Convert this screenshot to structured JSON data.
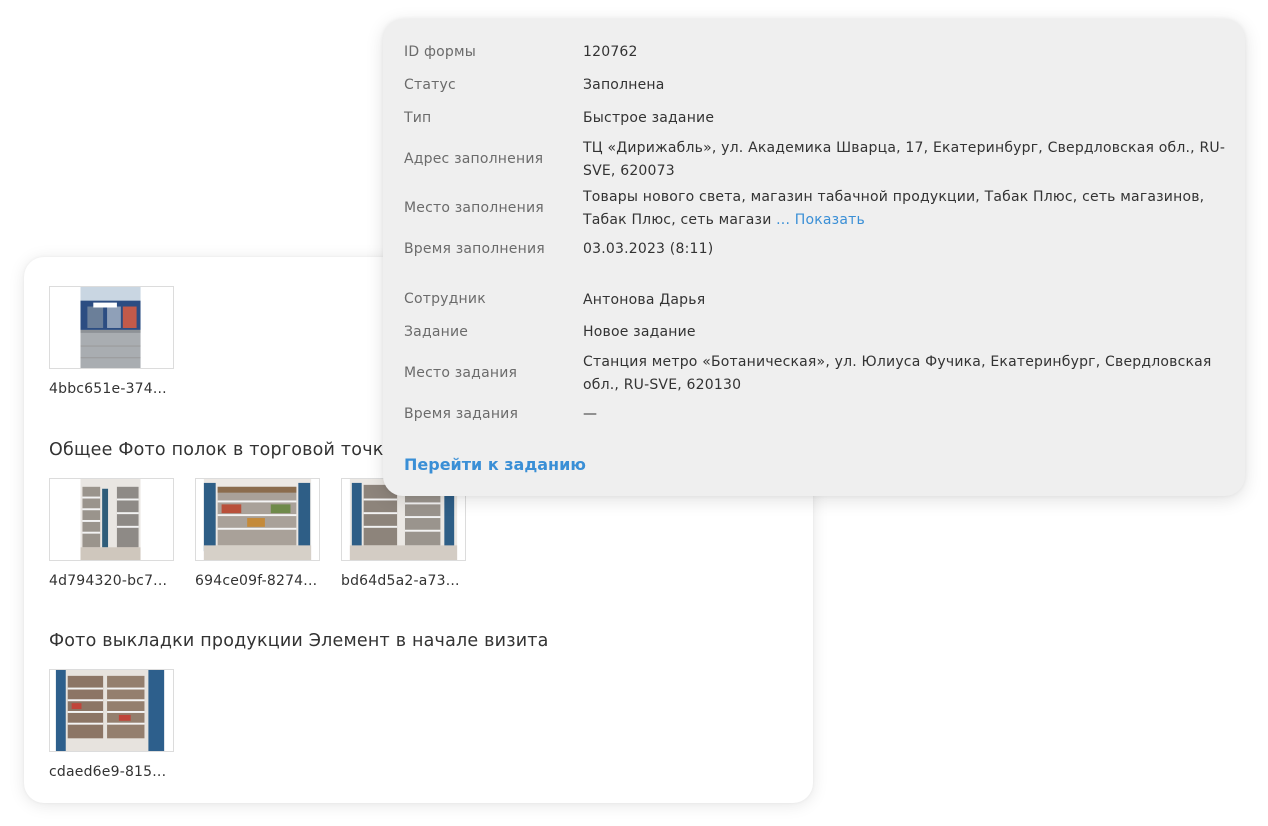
{
  "photos": {
    "top_group": {
      "items": [
        {
          "filename": "4bbc651e-374..."
        }
      ]
    },
    "groups": [
      {
        "title": "Общее Фото полок в торговой точке",
        "items": [
          {
            "filename": "4d794320-bc7..."
          },
          {
            "filename": "694ce09f-8274..."
          },
          {
            "filename": "bd64d5a2-a73..."
          }
        ]
      },
      {
        "title": "Фото выкладки продукции Элемент в начале визита",
        "items": [
          {
            "filename": "cdaed6e9-815..."
          }
        ]
      }
    ]
  },
  "info": {
    "rows": [
      {
        "label": "ID формы",
        "value": "120762"
      },
      {
        "label": "Статус",
        "value": "Заполнена"
      },
      {
        "label": "Тип",
        "value": "Быстрое задание"
      },
      {
        "label": "Адрес заполнения",
        "value": "ТЦ «Дирижабль», ул. Академика Шварца, 17, Екатеринбург, Свердловская обл., RU-SVE, 620073"
      },
      {
        "label": "Место заполнения",
        "value": "Товары нового света, магазин табачной продукции, Табак Плюс, сеть магазинов, Табак Плюс, сеть магази",
        "more": "... Показать"
      },
      {
        "label": "Время заполнения",
        "value": "03.03.2023 (8:11)"
      },
      {
        "label": "Сотрудник",
        "value": "Антонова Дарья"
      },
      {
        "label": "Задание",
        "value": "Новое задание"
      },
      {
        "label": "Место задания",
        "value": "Станция метро «Ботаническая», ул. Юлиуса Фучика, Екатеринбург, Свердловская обл., RU-SVE, 620130"
      },
      {
        "label": "Время задания",
        "value": "—"
      }
    ],
    "go_to_task_label": "Перейти к заданию"
  },
  "colors": {
    "link": "#3a8fd6",
    "info_bg": "#efefef",
    "label": "#6b6b6b",
    "text": "#333333"
  }
}
